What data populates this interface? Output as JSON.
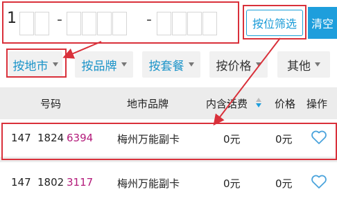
{
  "search": {
    "first_digit": "1",
    "dash": "-",
    "filter_label": "按位筛选",
    "clear_label": "清空"
  },
  "filters": [
    {
      "label": "按地市"
    },
    {
      "label": "按品牌"
    },
    {
      "label": "按套餐"
    },
    {
      "label": "按价格"
    },
    {
      "label": "其他"
    }
  ],
  "table": {
    "headers": {
      "number": "号码",
      "brand": "地市品牌",
      "fee": "内含话费",
      "price": "价格",
      "action": "操作"
    },
    "rows": [
      {
        "p1": "147",
        "p2": "1824",
        "p3": "6394",
        "brand": "梅州万能副卡",
        "fee": "0元",
        "price": "0元"
      },
      {
        "p1": "147",
        "p2": "1802",
        "p3": "3117",
        "brand": "梅州万能副卡",
        "fee": "0元",
        "price": "0元"
      }
    ]
  },
  "colors": {
    "accent": "#1e9edc",
    "highlight_red": "#d9303a",
    "number_highlight": "#b31a7a"
  },
  "icons": [
    "heart-icon",
    "sort-icon",
    "dropdown-triangle-icon"
  ]
}
